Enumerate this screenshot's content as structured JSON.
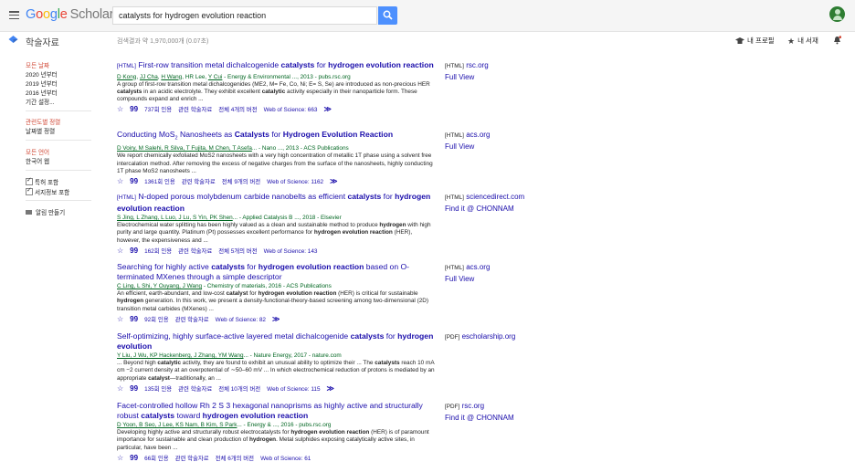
{
  "header": {
    "logo_google": [
      "G",
      "o",
      "o",
      "g",
      "l",
      "e"
    ],
    "logo_scholar": "Scholar",
    "search_value": "catalysts for hydrogen evolution reaction"
  },
  "subbar": {
    "section_title": "학술자료",
    "result_count": "검색결과 약 1,970,000개 (0.07초)",
    "my_profile": "내 프로필",
    "my_library": "내 서재"
  },
  "sidebar": {
    "any_time": "모든 날짜",
    "since_2020": "2020 년부터",
    "since_2019": "2019 년부터",
    "since_2016": "2016 년부터",
    "custom_range": "기간 설정...",
    "sort_relevance": "관련도별 정렬",
    "sort_date": "날짜별 정렬",
    "any_language": "모든 언어",
    "korean_only": "한국어 웹",
    "include_patents": "특허 포함",
    "include_citations": "서지정보 포함",
    "create_alert": "알림 만들기"
  },
  "results": [
    {
      "tag": "[HTML]",
      "title_parts": [
        "First-row transition metal dichalcogenide ",
        "catalysts",
        " for ",
        "hydrogen evolution reaction",
        ""
      ],
      "authors": [
        "D Kong",
        "JJ Cha",
        "H Wang"
      ],
      "authors_rest": ", HR Lee, ",
      "author_last": "Y Cui",
      "meta_tail": " - Energy & Environmental ..., 2013 - pubs.rsc.org",
      "snippet": "A group of first-row transition metal dichalcogenides (ME2, M= Fe, Co, Ni; E= S, Se) are introduced as non-precious HER catalysts in an acidic electrolyte. They exhibit excellent catalytic activity especially in their nanoparticle form. These compounds expand and enrich ...",
      "cited": "737회 인용",
      "related": "관련 학술자료",
      "versions": "전체 4개의 버전",
      "wos": "Web of Science: 663",
      "side_tag": "[HTML]",
      "side_domain": "rsc.org",
      "side_link": "Full View"
    },
    {
      "tag": "",
      "title_pre": "Conducting MoS",
      "title_sub": "2",
      "title_post": " Nanosheets as ",
      "title_b1": "Catalysts",
      "title_mid": " for ",
      "title_b2": "Hydrogen Evolution Reaction",
      "authors_line": "D Voiry, M Salehi, R Silva, T Fujita, M Chen, T Asefa",
      "meta_tail": "... - Nano ..., 2013 - ACS Publications",
      "snippet": "We report chemically exfoliated MoS2 nanosheets with a very high concentration of metallic 1T phase using a solvent free intercalation method. After removing the excess of negative charges from the surface of the nanosheets, highly conducting 1T phase MoS2 nanosheets ...",
      "cited": "1361회 인용",
      "related": "관련 학술자료",
      "versions": "전체 9개의 버전",
      "wos": "Web of Science: 1162",
      "side_tag": "[HTML]",
      "side_domain": "acs.org",
      "side_link": "Full View"
    },
    {
      "tag": "[HTML]",
      "title_a": "N-doped porous molybdenum carbide nanobelts as efficient ",
      "title_b1": "catalysts",
      "title_c": " for ",
      "title_b2": "hydrogen evolution reaction",
      "authors_line": "S Jing, L Zhang, L Luo, J Lu, S Yin, PK Shen",
      "meta_tail": "... - Applied Catalysis B ..., 2018 - Elsevier",
      "snippet": "Electrochemical water splitting has been highly valued as a clean and sustainable method to produce hydrogen with high purity and large quantity. Platinum (Pt) possesses excellent performance for hydrogen evolution reaction (HER), however, the expensiveness and ...",
      "cited": "162회 인용",
      "related": "관련 학술자료",
      "versions": "전체 5개의 버전",
      "wos": "Web of Science: 143",
      "side_tag": "[HTML]",
      "side_domain": "sciencedirect.com",
      "side_link": "Find it @ CHONNAM"
    },
    {
      "tag": "",
      "title_a": "Searching for highly active ",
      "title_b1": "catalysts",
      "title_c": " for ",
      "title_b2": "hydrogen evolution reaction",
      "title_d": " based on O-terminated MXenes through a simple descriptor",
      "authors_line": "C Ling, L Shi, Y Ouyang, J Wang",
      "meta_tail": " - Chemistry of materials, 2016 - ACS Publications",
      "snippet": "An efficient, earth-abundant, and low-cost catalyst for hydrogen evolution reaction (HER) is critical for sustainable hydrogen generation. In this work, we present a density-functional-theory-based screening among two-dimensional (2D) transition metal carbides (MXenes) ...",
      "cited": "92회 인용",
      "related": "관련 학술자료",
      "versions": "",
      "wos": "Web of Science: 82",
      "side_tag": "[HTML]",
      "side_domain": "acs.org",
      "side_link": "Full View"
    },
    {
      "tag": "",
      "title_a": "Self-optimizing, highly surface-active layered metal dichalcogenide ",
      "title_b1": "catalysts",
      "title_c": " for ",
      "title_b2": "hydrogen evolution",
      "authors_line": "Y Liu, J Wu, KP Hackenberg, J Zhang, YM Wang",
      "meta_tail": "... - Nature Energy, 2017 - nature.com",
      "snippet": "... Beyond high catalytic activity, they are found to exhibit an unusual ability to optimize their ... The catalysts reach 10 mA cm −2 current density at an overpotential of ∼50–60 mV ... In which electrochemical reduction of protons is mediated by an appropriate catalyst—traditionally, an ...",
      "cited": "135회 인용",
      "related": "관련 학술자료",
      "versions": "전체 10개의 버전",
      "wos": "Web of Science: 115",
      "side_tag": "[PDF]",
      "side_domain": "escholarship.org",
      "side_link": ""
    },
    {
      "tag": "",
      "title_a": "Facet-controlled hollow Rh 2 S 3 hexagonal nanoprisms as highly active and structurally robust ",
      "title_b1": "catalysts",
      "title_c": " toward ",
      "title_b2": "hydrogen evolution reaction",
      "authors_line": "D Yoon, B Seo, J Lee, KS Nam, B Kim, S Park",
      "meta_tail": "... - Energy & ..., 2016 - pubs.rsc.org",
      "snippet": "Developing highly active and structurally robust electrocatalysts for hydrogen evolution reaction (HER) is of paramount importance for sustainable and clean production of hydrogen. Metal sulphides exposing catalytically active sites, in particular, have been ...",
      "cited": "66회 인용",
      "related": "관련 학술자료",
      "versions": "전체 6개의 버전",
      "wos": "Web of Science: 61",
      "side_tag": "[PDF]",
      "side_domain": "rsc.org",
      "side_link": "Find it @ CHONNAM"
    }
  ],
  "colors": {
    "link": "#1a0dab",
    "green": "#006621",
    "red": "#d14836",
    "search_btn": "#4d90fe"
  }
}
